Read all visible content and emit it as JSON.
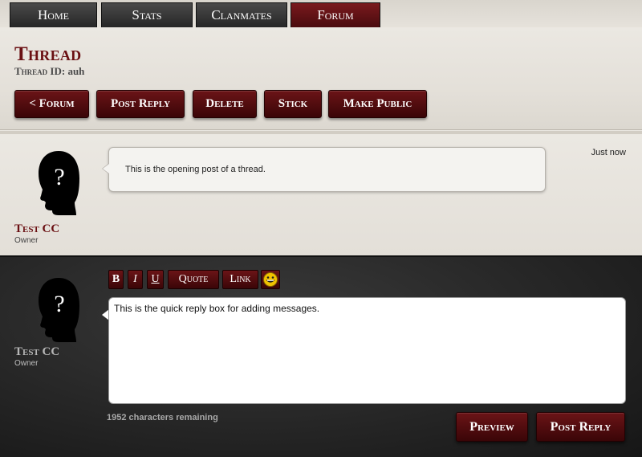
{
  "nav": {
    "tabs": [
      {
        "label": "Home",
        "active": false
      },
      {
        "label": "Stats",
        "active": false
      },
      {
        "label": "Clanmates",
        "active": false
      },
      {
        "label": "Forum",
        "active": true
      }
    ]
  },
  "header": {
    "title": "Thread",
    "thread_id_label": "Thread ID:",
    "thread_id_value": "auh"
  },
  "actions": {
    "back": "< Forum",
    "post_reply": "Post Reply",
    "delete": "Delete",
    "stick": "Stick",
    "make_public": "Make Public"
  },
  "post": {
    "username": "Test CC",
    "role": "Owner",
    "text": "This is the opening post of a thread.",
    "timestamp": "Just now",
    "avatar_icon": "unknown-user-silhouette-icon"
  },
  "reply": {
    "username": "Test CC",
    "role": "Owner",
    "avatar_icon": "unknown-user-silhouette-icon",
    "toolbar": {
      "bold": "B",
      "italic": "I",
      "underline": "U",
      "quote": "Quote",
      "link": "Link",
      "emoji_icon": "grinning-face-icon"
    },
    "text": "This is the quick reply box for adding messages.",
    "chars_remaining": "1952 characters remaining",
    "preview_label": "Preview",
    "post_reply_label": "Post Reply"
  },
  "colors": {
    "accent": "#6a0f12",
    "button_top": "#6b1417",
    "button_bottom": "#3a0507",
    "nav_dark": "#262626"
  }
}
